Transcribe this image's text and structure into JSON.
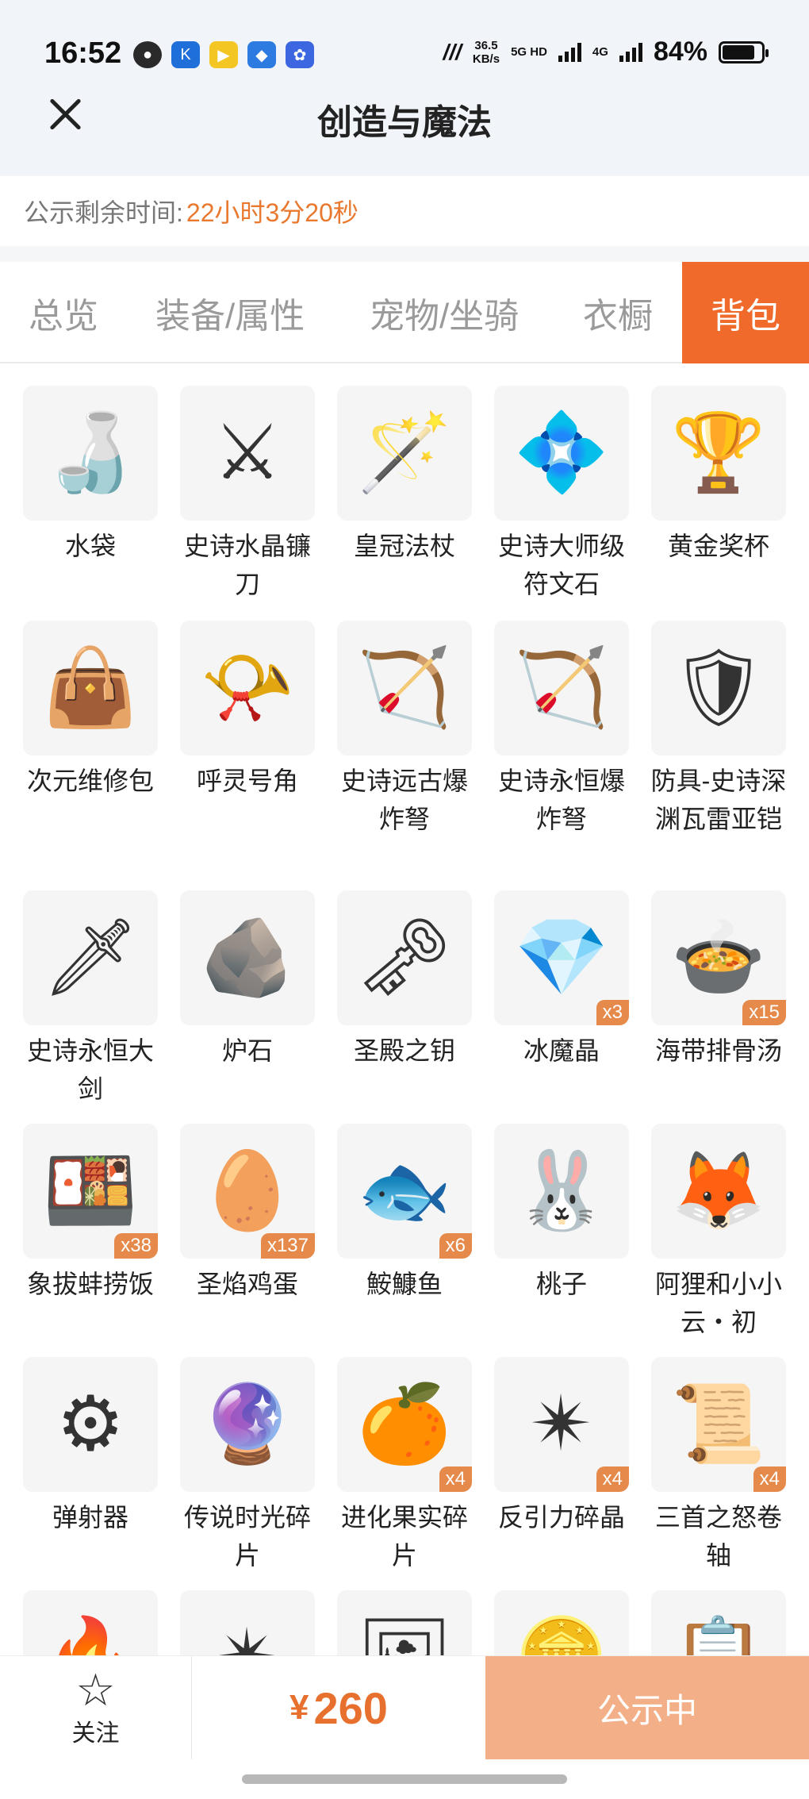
{
  "status": {
    "time": "16:52",
    "speed": "36.5",
    "speed_unit": "KB/s",
    "net1": "5G HD",
    "net2": "4G",
    "battery": "84%",
    "battery_level": 0.84
  },
  "header": {
    "title": "创造与魔法"
  },
  "notice": {
    "label": "公示剩余时间:",
    "value": "22小时3分20秒"
  },
  "tabs": [
    {
      "label": "总览"
    },
    {
      "label": "装备/属性"
    },
    {
      "label": "宠物/坐骑"
    },
    {
      "label": "衣橱"
    },
    {
      "label": "背包"
    }
  ],
  "active_tab": "背包",
  "items": [
    {
      "name": "水袋",
      "icon": "🍶"
    },
    {
      "name": "史诗水晶镰刀",
      "icon": "⚔"
    },
    {
      "name": "皇冠法杖",
      "icon": "🪄"
    },
    {
      "name": "史诗大师级符文石",
      "icon": "💠"
    },
    {
      "name": "黄金奖杯",
      "icon": "🏆"
    },
    {
      "name": "次元维修包",
      "icon": "👜"
    },
    {
      "name": "呼灵号角",
      "icon": "📯"
    },
    {
      "name": "史诗远古爆炸弩",
      "icon": "🏹"
    },
    {
      "name": "史诗永恒爆炸弩",
      "icon": "🏹"
    },
    {
      "name": "防具-史诗深渊瓦雷亚铠",
      "icon": "🛡"
    },
    {
      "name": "史诗永恒大剑",
      "icon": "🗡"
    },
    {
      "name": "炉石",
      "icon": "🪨"
    },
    {
      "name": "圣殿之钥",
      "icon": "🗝"
    },
    {
      "name": "冰魔晶",
      "icon": "💎",
      "qty": "x3"
    },
    {
      "name": "海带排骨汤",
      "icon": "🍲",
      "qty": "x15"
    },
    {
      "name": "象拔蚌捞饭",
      "icon": "🍱",
      "qty": "x38"
    },
    {
      "name": "圣焰鸡蛋",
      "icon": "🥚",
      "qty": "x137"
    },
    {
      "name": "鮟鱇鱼",
      "icon": "🐟",
      "qty": "x6"
    },
    {
      "name": "桃子",
      "icon": "🐰"
    },
    {
      "name": "阿狸和小小云・初",
      "icon": "🦊"
    },
    {
      "name": "弹射器",
      "icon": "⚙"
    },
    {
      "name": "传说时光碎片",
      "icon": "🔮"
    },
    {
      "name": "进化果实碎片",
      "icon": "🍊",
      "qty": "x4"
    },
    {
      "name": "反引力碎晶",
      "icon": "✴",
      "qty": "x4"
    },
    {
      "name": "三首之怒卷轴",
      "icon": "📜",
      "qty": "x4"
    },
    {
      "name": "",
      "icon": "🔥"
    },
    {
      "name": "",
      "icon": "✴"
    },
    {
      "name": "",
      "icon": "🖼"
    },
    {
      "name": "",
      "icon": "🪙"
    },
    {
      "name": "",
      "icon": "📋"
    }
  ],
  "bottom": {
    "follow_label": "关注",
    "currency": "¥",
    "price": "260",
    "status_label": "公示中"
  }
}
